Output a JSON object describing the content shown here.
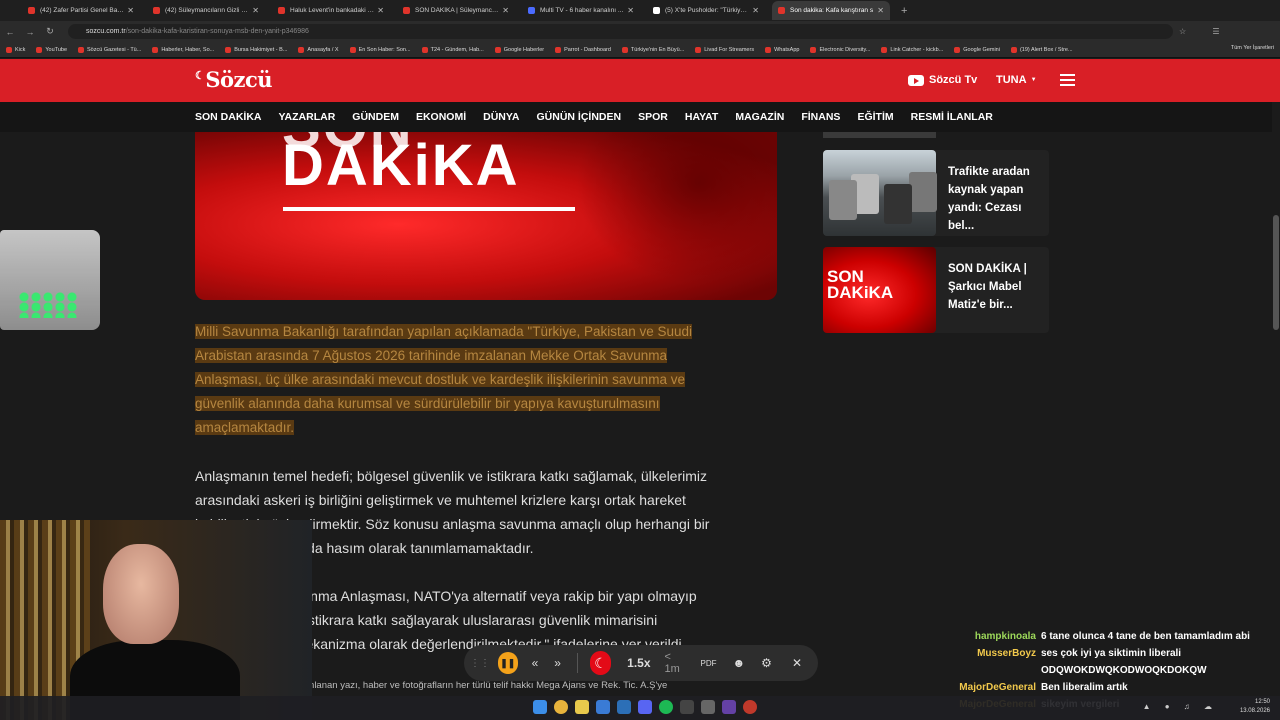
{
  "browser": {
    "tabs": [
      {
        "title": "(42) Zafer Partisi Genel Başkanı",
        "active": false
      },
      {
        "title": "(42) Süleymancıların Gizli Dosyası",
        "active": false
      },
      {
        "title": "Haluk Levent'in bankadaki kasası",
        "active": false
      },
      {
        "title": "SON DAKİKA | Süleymancılara T...",
        "active": false
      },
      {
        "title": "Multi TV - 6 haber kanalını ...",
        "active": false
      },
      {
        "title": "(5) X'te Pusholder: \"Türkiye, kendi",
        "active": false
      },
      {
        "title": "Son dakika: Kafa karıştıran s",
        "active": true
      }
    ],
    "url_host": "sozcu.com.tr",
    "url_path": "/son-dakika-kafa-karistiran-sonuya-msb-den-yanit-p346986",
    "bookmarks": [
      "Kick",
      "YouTube",
      "Sözcü Gazetesi - Tü...",
      "Haberler, Haber, So...",
      "Bursa Hakimiyet - B...",
      "Anasayfa / X",
      "En Son Haber: Son...",
      "T24 - Gündem, Hab...",
      "Google Haberler",
      "Parrot - Dashboard",
      "Türkiye'nin En Büyü...",
      "Livad For Streamers",
      "WhatsApp",
      "Electronic Diversity...",
      "Link Catcher - kickb...",
      "Google Gemini",
      "(19) Alert Box / Stre..."
    ],
    "bookmarks_more": "Tüm Yer İşaretleri"
  },
  "site": {
    "logo": "Sözcü",
    "tv_label": "Sözcü Tv",
    "user_label": "TUNA",
    "nav": [
      "SON DAKİKA",
      "YAZARLAR",
      "GÜNDEM",
      "EKONOMİ",
      "DÜNYA",
      "GÜNÜN İÇİNDEN",
      "SPOR",
      "HAYAT",
      "MAGAZİN",
      "FİNANS",
      "EĞİTİM",
      "RESMİ İLANLAR"
    ]
  },
  "article": {
    "hero_text": "DAKiKA",
    "hero_text_top": "SON",
    "lead_lines": [
      "Milli Savunma Bakanlığı tarafından yapılan açıklamada \"Türkiye, Pakistan ve Suudi",
      "Arabistan arasında 7 Ağustos 2026 tarihinde imzalanan Mekke Ortak Savunma",
      "Anlaşması, üç ülke arasındaki mevcut dostluk ve kardeşlik ilişkilerinin savunma ve",
      "güvenlik alanında daha kurumsal ve sürdürülebilir bir yapıya kavuşturulmasını",
      "amaçlamaktadır."
    ],
    "p1_lines": [
      "Anlaşmanın temel hedefi; bölgesel güvenlik ve istikrara katkı sağlamak, ülkelerimiz",
      "arasındaki askeri iş birliğini geliştirmek ve muhtemel krizlere karşı ortak hareket",
      "kabiliyetini güçlendirmektir. Söz konusu anlaşma savunma amaçlı olup herhangi bir",
      "ülkeyi düşman ya da hasım olarak tanımlamamaktadır."
    ],
    "p2_lines": [
      "Mekke Ortak Savunma Anlaşması, NATO'ya alternatif veya rakip bir yapı olmayıp",
      "bölgesel barış ve istikrara katkı sağlayarak uluslararası güvenlik mimarisini",
      "tamamlayıcı bir mekanizma olarak değerlendirilmektedir.\" ifadelerine yer verildi."
    ],
    "copyright": "sözcü.com.tr sitesinde yayınlanan yazı, haber ve fotoğrafların her türlü telif hakkı Mega Ajans ve Rek. Tic. A.Ş'ye"
  },
  "sidebar": {
    "cards": [
      {
        "title_lines": [
          "Trafikte aradan",
          "kaynak yapan",
          "yandı: Cezası bel..."
        ]
      },
      {
        "title_lines": [
          "SON DAKİKA |",
          "Şarkıcı Mabel",
          "Matiz'e bir..."
        ],
        "thumb_text": "SON DAKiKA"
      }
    ]
  },
  "media_bar": {
    "speed": "1.5x",
    "time_left": "< 1m",
    "pdf_label": "PDF"
  },
  "chat": [
    {
      "nick": "hampkinoala",
      "msg": "6 tane olunca 4 tane de ben tamamladım abi",
      "color": "#9dd85a"
    },
    {
      "nick": "MusserBoyz",
      "msg": "ses çok iyi ya siktimin liberali",
      "color": "#f2c94c"
    },
    {
      "nick": "",
      "msg": "ODQWOKDWQKODWOQKDOKQW",
      "color": "#f2c94c"
    },
    {
      "nick": "MajorDeGeneral",
      "msg": "Ben liberalim artık",
      "color": "#f2c94c"
    },
    {
      "nick": "MajorDeGeneral",
      "msg": "sikeyim vergileri",
      "color": "#f2c94c"
    }
  ],
  "taskbar": {
    "time": "12:50",
    "date": "13.08.2026"
  }
}
